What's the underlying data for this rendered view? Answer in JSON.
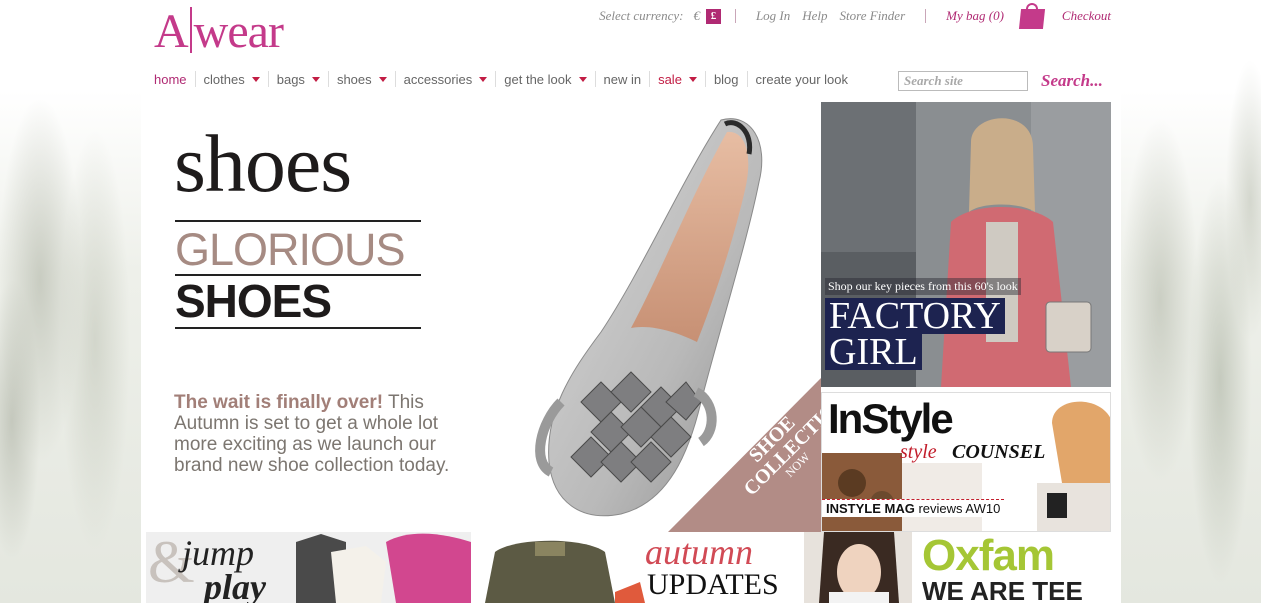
{
  "brand": {
    "logo_left": "A",
    "logo_right": "wear"
  },
  "topbar": {
    "currency_label": "Select currency:",
    "currency_euro": "€",
    "currency_pound": "£",
    "login": "Log In",
    "help": "Help",
    "store_finder": "Store Finder",
    "my_bag": "My bag (0)",
    "checkout": "Checkout"
  },
  "nav": {
    "items": [
      {
        "label": "home",
        "dropdown": false
      },
      {
        "label": "clothes",
        "dropdown": true
      },
      {
        "label": "bags",
        "dropdown": true
      },
      {
        "label": "shoes",
        "dropdown": true
      },
      {
        "label": "accessories",
        "dropdown": true
      },
      {
        "label": "get the look",
        "dropdown": true
      },
      {
        "label": "new in",
        "dropdown": false
      },
      {
        "label": "sale",
        "dropdown": true
      },
      {
        "label": "blog",
        "dropdown": false
      },
      {
        "label": "create your look",
        "dropdown": false
      }
    ]
  },
  "search": {
    "placeholder": "Search site",
    "button": "Search..."
  },
  "hero": {
    "line1": "shoes",
    "line2": "GLORIOUS",
    "line3": "SHOES",
    "lead": "The wait is finally over!",
    "body": " This Autumn is set to get a whole lot more exciting as we launch our brand new shoe collection today.",
    "cta_top": "SHOP OUR",
    "cta_mid": "SHOE COLLECTION",
    "cta_bottom": "NOW"
  },
  "factory": {
    "subtitle": "Shop our key pieces from this 60's look",
    "title1": "FACTORY",
    "title2": "GIRL"
  },
  "instyle": {
    "title": "InStyle",
    "style": "style",
    "counsel": "COUNSEL",
    "reviews_bold": "INSTYLE MAG",
    "reviews_rest": " reviews AW10"
  },
  "tiles": {
    "jump_amp": "&",
    "jump_text": "jump",
    "jump_text2": "play",
    "autumn": "autumn",
    "updates": "UPDATES",
    "oxfam": "Oxfam",
    "we_are_tee": "WE ARE TEE"
  },
  "colors": {
    "brand": "#c43a8a",
    "sale": "#c21d44",
    "panel_navy": "#1d2350",
    "cta": "#b28c86"
  }
}
